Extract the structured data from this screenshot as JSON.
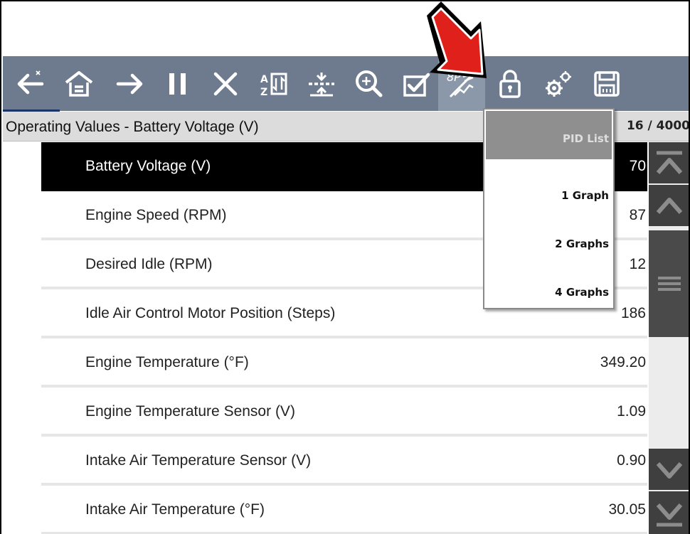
{
  "toolbar": {
    "buttons": [
      {
        "icon": "back-icon"
      },
      {
        "icon": "home-icon"
      },
      {
        "icon": "forward-icon"
      },
      {
        "icon": "pause-icon"
      },
      {
        "icon": "close-icon"
      },
      {
        "icon": "sort-icon"
      },
      {
        "icon": "collapse-icon"
      },
      {
        "icon": "zoom-icon"
      },
      {
        "icon": "checklist-icon"
      },
      {
        "icon": "graph-view-icon"
      },
      {
        "icon": "lock-icon"
      },
      {
        "icon": "settings-icon"
      },
      {
        "icon": "save-icon"
      }
    ],
    "active_button": "graph-view-icon"
  },
  "header": {
    "title": "Operating Values - Battery Voltage (V)",
    "count": "16 / 4000"
  },
  "rows": [
    {
      "name": "Battery Voltage (V)",
      "value": "70",
      "selected": true
    },
    {
      "name": "Engine Speed (RPM)",
      "value": "87"
    },
    {
      "name": "Desired Idle (RPM)",
      "value": "12"
    },
    {
      "name": "Idle Air Control Motor Position (Steps)",
      "value": "186"
    },
    {
      "name": "Engine Temperature (°F)",
      "value": "349.20"
    },
    {
      "name": "Engine Temperature Sensor (V)",
      "value": "1.09"
    },
    {
      "name": "Intake Air Temperature Sensor (V)",
      "value": "0.90"
    },
    {
      "name": "Intake Air Temperature (°F)",
      "value": "30.05"
    }
  ],
  "dropdown": {
    "items": [
      {
        "label": "PID List",
        "active": true
      },
      {
        "label": "1 Graph"
      },
      {
        "label": "2 Graphs"
      },
      {
        "label": "4 Graphs"
      }
    ]
  },
  "colors": {
    "toolbar": "#6e7b8e",
    "selected_row": "#000000",
    "callout_arrow": "#e0201b"
  }
}
